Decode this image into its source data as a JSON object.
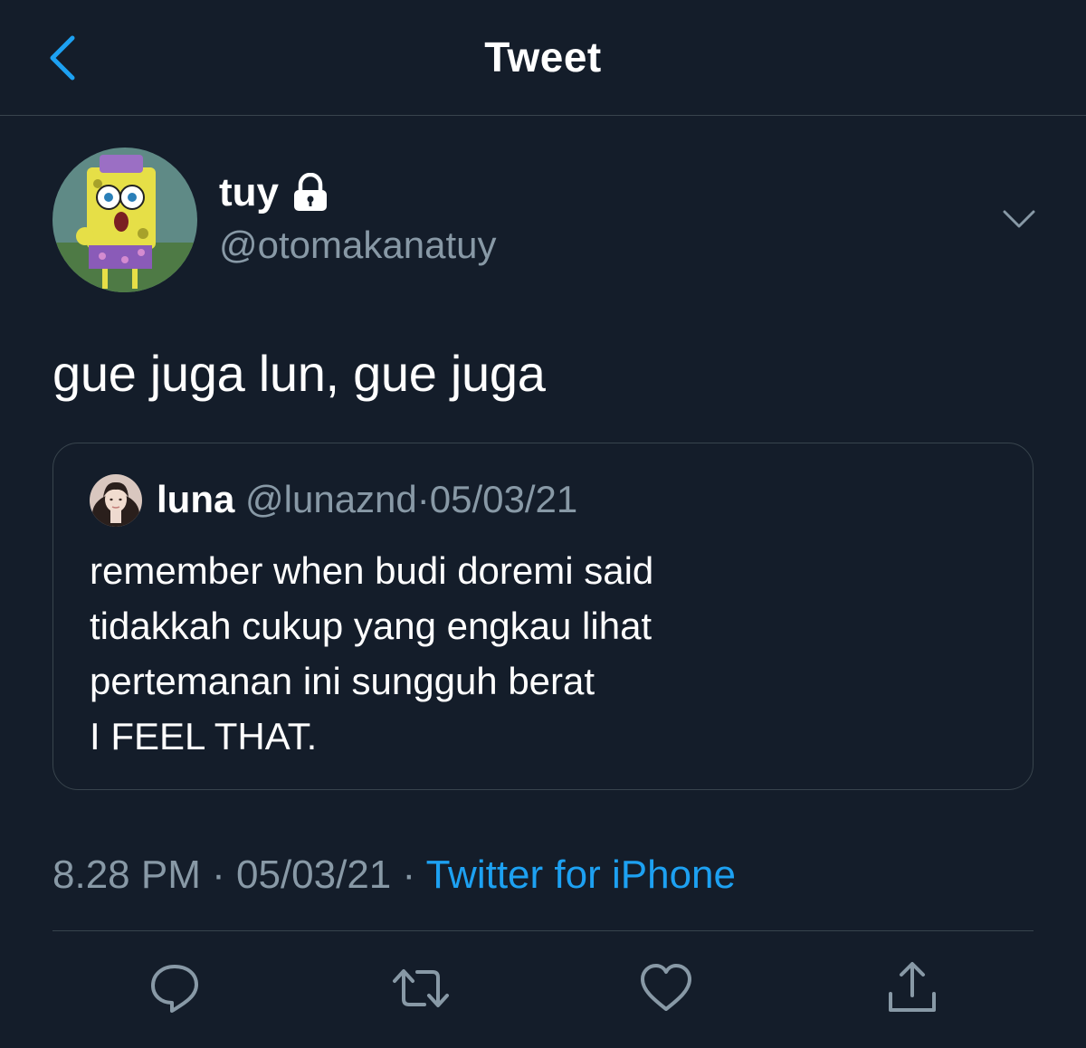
{
  "header": {
    "title": "Tweet",
    "back_icon": "chevron-left-icon"
  },
  "author": {
    "display_name": "tuy",
    "handle": "@otomakanatuy",
    "protected_icon": "lock-icon"
  },
  "tweet": {
    "text": "gue juga lun, gue juga"
  },
  "quoted_tweet": {
    "name": "luna",
    "handle": "@lunaznd",
    "separator": "·",
    "date": "05/03/21",
    "lines": [
      "remember when budi doremi said",
      "tidakkah cukup yang engkau lihat",
      "pertemanan ini sungguh berat",
      "I FEEL THAT."
    ]
  },
  "meta": {
    "time": "8.28 PM",
    "separator": "·",
    "date": "05/03/21",
    "source": "Twitter for iPhone"
  },
  "actions": {
    "reply": "reply-icon",
    "retweet": "retweet-icon",
    "like": "heart-icon",
    "share": "share-icon"
  },
  "colors": {
    "background": "#141d2a",
    "accent": "#1da1f2",
    "secondary_text": "#8899a6",
    "border": "#38444d"
  }
}
